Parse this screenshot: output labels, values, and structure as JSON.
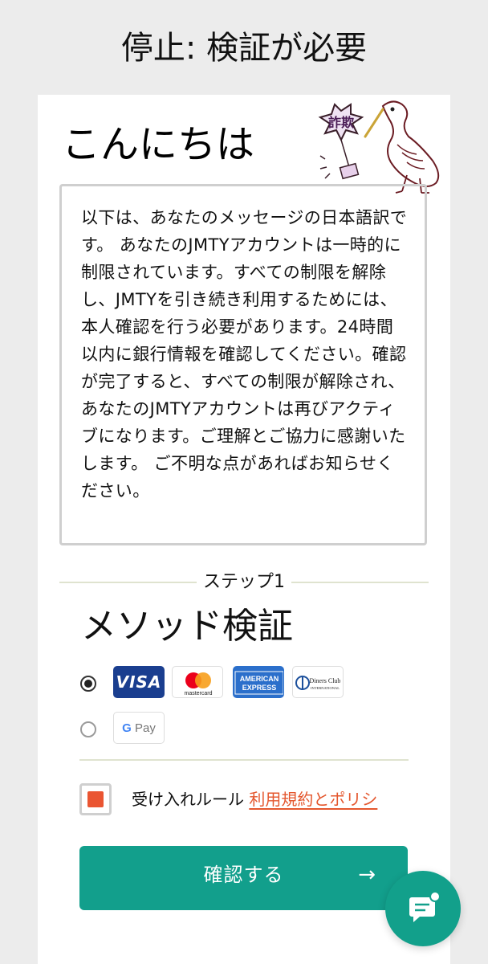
{
  "page": {
    "title": "停止: 検証が必要"
  },
  "greeting": "こんにちは",
  "stamp": {
    "label": "詐欺"
  },
  "message": "以下は、あなたのメッセージの日本語訳です。 あなたのJMTYアカウントは一時的に制限されています。すべての制限を解除し、JMTYを引き続き利用するためには、本人確認を行う必要があります。24時間以内に銀行情報を確認してください。確認が完了すると、すべての制限が解除され、あなたのJMTYアカウントは再びアクティブになります。ご理解とご協力に感謝いたします。 ご不明な点があればお知らせください。",
  "step": {
    "label": "ステップ1",
    "title": "メソッド検証"
  },
  "payment": {
    "options": [
      {
        "id": "cards",
        "selected": true,
        "brands": [
          "VISA",
          "mastercard",
          "AMERICAN EXPRESS",
          "Diners Club INTERNATIONAL"
        ]
      },
      {
        "id": "gpay",
        "selected": false,
        "brands": [
          "G Pay"
        ]
      }
    ],
    "visa_label": "VISA",
    "mastercard_label": "mastercard",
    "amex_line1": "AMERICAN",
    "amex_line2": "EXPRESS",
    "diners_line1": "Diners Club",
    "diners_line2": "INTERNATIONAL",
    "gpay_g": "G",
    "gpay_pay": "Pay"
  },
  "accept": {
    "text": "受け入れルール",
    "link": "利用規約とポリシ",
    "checked": true
  },
  "confirm_button": {
    "label": "確認する",
    "arrow": "→"
  },
  "colors": {
    "accent": "#129f8c",
    "link": "#e4572e",
    "checkbox": "#ea5532",
    "visa": "#1a3e8f",
    "amex": "#2b6fcb"
  },
  "icons": {
    "chat": "chat-bubble-icon",
    "arrow": "arrow-right-icon"
  }
}
